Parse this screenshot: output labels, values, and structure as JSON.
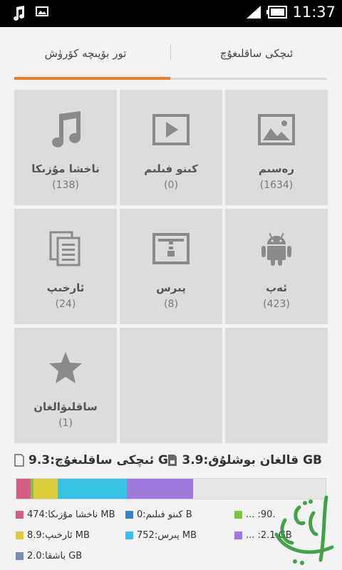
{
  "status_bar": {
    "time": "11:37",
    "left_icons": [
      "music-note-icon",
      "image-notification-icon"
    ],
    "right_icons": [
      "signal-icon",
      "battery-icon"
    ]
  },
  "tabs": [
    {
      "label": "تور بۆيىچە كۆرۈش",
      "active": false
    },
    {
      "label": "ئىچكى ساقلىغۇچ",
      "active": true
    }
  ],
  "categories": [
    {
      "label": "ناخشا مۇزىكا",
      "count": "(138)",
      "icon": "music-note-icon"
    },
    {
      "label": "كىنو فىلىم",
      "count": "(0)",
      "icon": "video-icon"
    },
    {
      "label": "رەسىم",
      "count": "(1634)",
      "icon": "picture-icon"
    },
    {
      "label": "ئارخىپ",
      "count": "(24)",
      "icon": "document-icon"
    },
    {
      "label": "پىرس",
      "count": "(8)",
      "icon": "archive-icon"
    },
    {
      "label": "ئەپ",
      "count": "(423)",
      "icon": "android-icon"
    },
    {
      "label": "ساقلىۋالغان",
      "count": "(1)",
      "icon": "star-icon"
    }
  ],
  "storage": {
    "internal": "ئىچكى ساقلىغۇچ:9.3 GB",
    "free": "قالغان بوشلۇق:3.9 GB"
  },
  "usage_segments": [
    {
      "color": "#d65a86",
      "fraction": 0.047
    },
    {
      "color": "#7fc242",
      "fraction": 0.009
    },
    {
      "color": "#dccc3c",
      "fraction": 0.078
    },
    {
      "color": "#36c2e4",
      "fraction": 0.224
    },
    {
      "color": "#9e78dc",
      "fraction": 0.214
    }
  ],
  "legend": [
    {
      "text": "ناخشا مۇزىكا:474 MB",
      "color": "#d65a86"
    },
    {
      "text": "كىنو فىلىم:0 B",
      "color": "#3c82c8"
    },
    {
      "text": "... :90.",
      "color": "#7fc242"
    },
    {
      "text": "ئارخىپ:8.9 MB",
      "color": "#dccc3c"
    },
    {
      "text": "پىرس:752 MB",
      "color": "#36c2e4"
    },
    {
      "text": "... :2.1 GB",
      "color": "#9e78dc"
    },
    {
      "text": "باشقا:2.0 GB",
      "color": "#7890b4"
    }
  ],
  "colors": {
    "accent": "#f07d1a",
    "tile_bg": "#dcdcdc",
    "icon_gray": "#8a8a8a"
  }
}
